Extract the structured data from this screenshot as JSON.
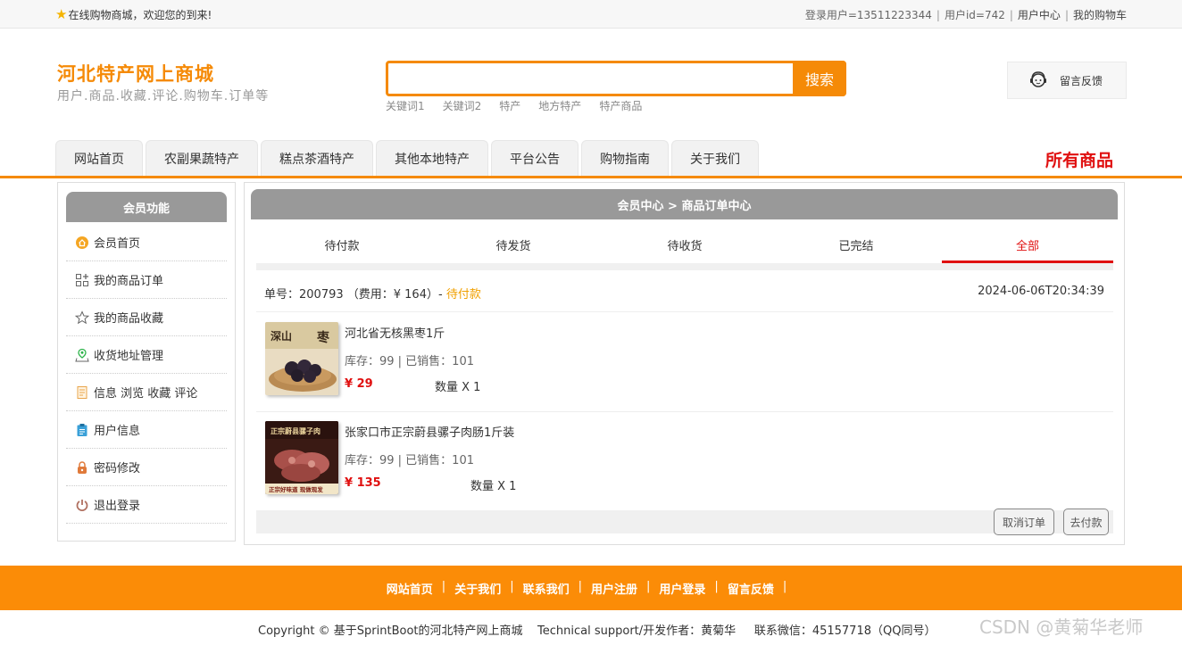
{
  "topbar": {
    "welcome": "在线购物商城，欢迎您的到来!",
    "user_label": "登录用户=13511223344",
    "userid_label": "用户id=742",
    "user_center": "用户中心",
    "cart": "我的购物车",
    "sep": "|"
  },
  "header": {
    "logo_title": "河北特产网上商城",
    "logo_sub": "用户.商品.收藏.评论.购物车.订单等",
    "search_value": "",
    "search_button": "搜索",
    "keywords": [
      "关键词1",
      "关键词2",
      "特产",
      "地方特产",
      "特产商品"
    ],
    "feedback": "留言反馈"
  },
  "nav": {
    "tabs": [
      "网站首页",
      "农副果蔬特产",
      "糕点茶酒特产",
      "其他本地特产",
      "平台公告",
      "购物指南",
      "关于我们"
    ],
    "all_products": "所有商品"
  },
  "sidebar": {
    "title": "会员功能",
    "items": [
      {
        "label": "会员首页",
        "icon": "home-icon"
      },
      {
        "label": "我的商品订单",
        "icon": "grid-icon"
      },
      {
        "label": "我的商品收藏",
        "icon": "star-icon"
      },
      {
        "label": "收货地址管理",
        "icon": "location-icon"
      },
      {
        "label": "信息 浏览 收藏 评论",
        "icon": "document-icon"
      },
      {
        "label": "用户信息",
        "icon": "clipboard-icon"
      },
      {
        "label": "密码修改",
        "icon": "lock-icon"
      },
      {
        "label": "退出登录",
        "icon": "power-icon"
      }
    ]
  },
  "main": {
    "breadcrumb": "会员中心 > 商品订单中心",
    "tabs": [
      "待付款",
      "待发货",
      "待收货",
      "已完结",
      "全部"
    ],
    "active_tab": "全部",
    "order": {
      "prefix": "单号：200793 （费用：¥ 164）-",
      "status": "待付款",
      "time": "2024-06-06T20:34:39"
    },
    "items": [
      {
        "name": "河北省无核黑枣1斤",
        "stock": "库存：99 | 已销售：101",
        "price": "¥ 29",
        "qty": "数量 X 1"
      },
      {
        "name": "张家口市正宗蔚县骡子肉肠1斤装",
        "stock": "库存：99 | 已销售：101",
        "price": "¥ 135",
        "qty": "数量 X 1"
      }
    ],
    "cancel_button": "取消订单",
    "pay_button": "去付款"
  },
  "footer": {
    "links": [
      "网站首页",
      "关于我们",
      "联系我们",
      "用户注册",
      "用户登录",
      "留言反馈"
    ],
    "sep": "|",
    "copyright": "Copyright © 基于SprintBoot的河北特产网上商城    Technical support/开发作者：黄菊华     联系微信：45157718（QQ同号）",
    "watermark": "CSDN @黄菊华老师"
  },
  "colors": {
    "accent": "#f58a07",
    "red": "#e01010",
    "header_gray": "#999999",
    "pending": "#f0a000"
  },
  "thumb_text": {
    "item1_a": "深山",
    "item1_b": "枣",
    "item2_top": "正宗蔚县骡子肉",
    "item2_bottom": "正宗好味道 现做现发"
  }
}
